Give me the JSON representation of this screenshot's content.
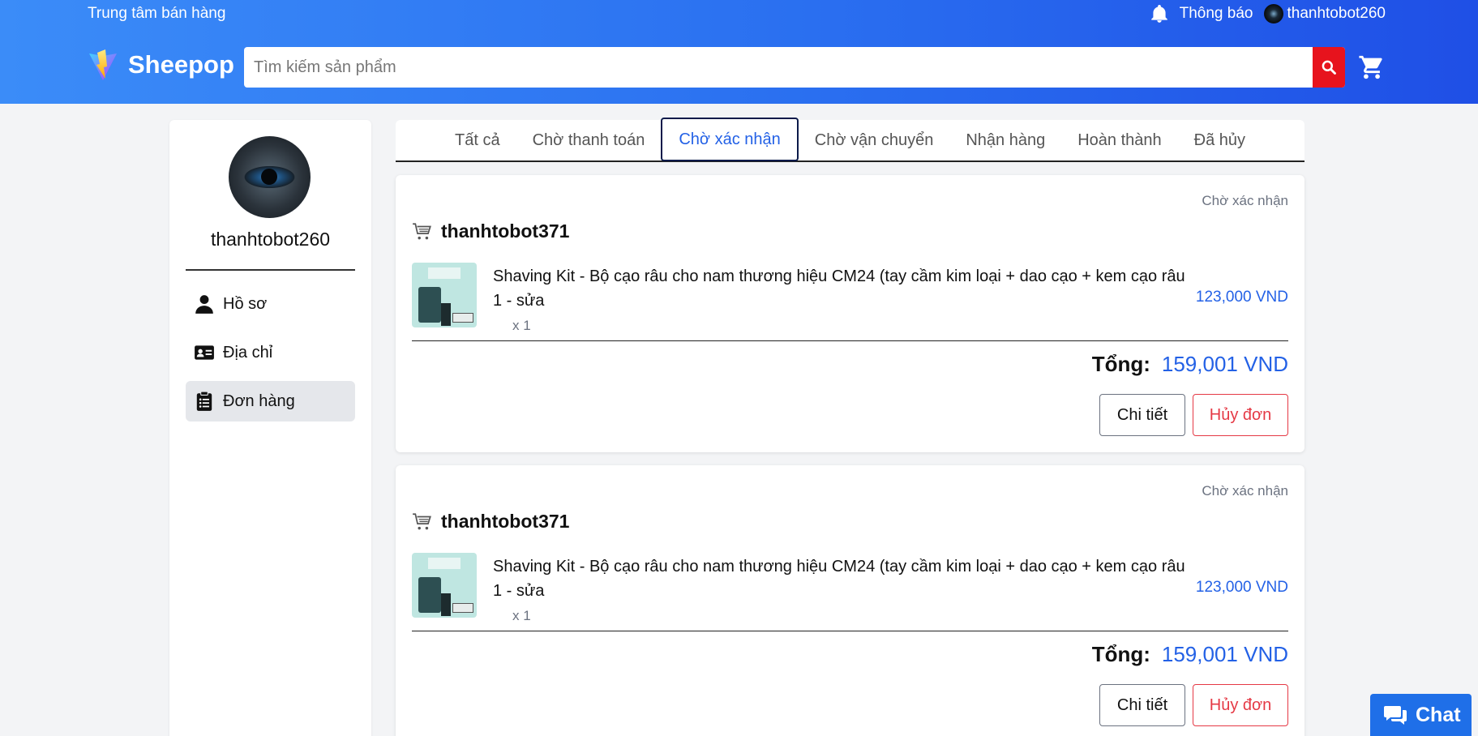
{
  "header": {
    "seller_center": "Trung tâm bán hàng",
    "notifications": "Thông báo",
    "username": "thanhtobot260",
    "brand": "Sheepop",
    "search_placeholder": "Tìm kiếm sản phẩm"
  },
  "sidebar": {
    "username": "thanhtobot260",
    "items": [
      {
        "label": "Hồ sơ",
        "icon": "user-icon"
      },
      {
        "label": "Địa chỉ",
        "icon": "id-card-icon"
      },
      {
        "label": "Đơn hàng",
        "icon": "clipboard-icon",
        "active": true
      }
    ]
  },
  "tabs": [
    {
      "label": "Tất cả"
    },
    {
      "label": "Chờ thanh toán"
    },
    {
      "label": "Chờ xác nhận",
      "active": true
    },
    {
      "label": "Chờ vận chuyển"
    },
    {
      "label": "Nhận hàng"
    },
    {
      "label": "Hoàn thành"
    },
    {
      "label": "Đã hủy"
    }
  ],
  "orders": [
    {
      "status": "Chờ xác nhận",
      "shop": "thanhtobot371",
      "product_name": "Shaving Kit - Bộ cạo râu cho nam thương hiệu CM24 (tay cầm kim loại + dao cạo + kem cạo râu 1 - sửa",
      "quantity": "x 1",
      "price": "123,000 VND",
      "total_label": "Tổng:",
      "total_value": "159,001 VND",
      "detail_label": "Chi tiết",
      "cancel_label": "Hủy đơn"
    },
    {
      "status": "Chờ xác nhận",
      "shop": "thanhtobot371",
      "product_name": "Shaving Kit - Bộ cạo râu cho nam thương hiệu CM24 (tay cầm kim loại + dao cạo + kem cạo râu 1 - sửa",
      "quantity": "x 1",
      "price": "123,000 VND",
      "total_label": "Tổng:",
      "total_value": "159,001 VND",
      "detail_label": "Chi tiết",
      "cancel_label": "Hủy đơn"
    }
  ],
  "chat": {
    "label": "Chat",
    "icon": "chat-icon"
  },
  "colors": {
    "header_start": "#3b8cf8",
    "header_end": "#1f4fe6",
    "accent": "#2361e6",
    "danger": "#e53945",
    "search_button": "#e7131d"
  }
}
